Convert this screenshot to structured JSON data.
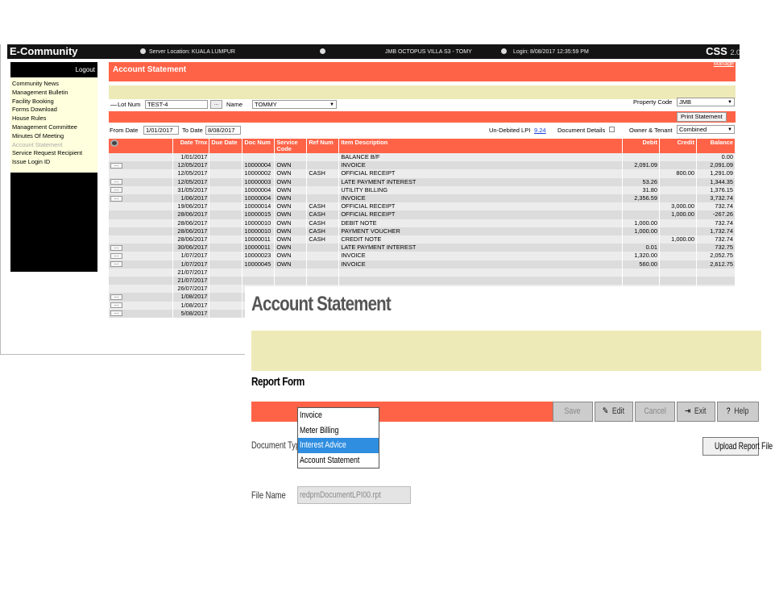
{
  "app": {
    "brand": "E-Community",
    "server_location": "Server Location: KUALA LUMPUR",
    "property": "JMB OCTOPUS VILLA S3 - TOMY",
    "login": "Login: 8/08/2017 12:35:59 PM",
    "product": "CSS",
    "version": "2.0"
  },
  "sidebar": {
    "logout": "Logout",
    "items": [
      {
        "label": "Community News"
      },
      {
        "label": "Management Bulletin"
      },
      {
        "label": "Facility Booking"
      },
      {
        "label": "Forms Download"
      },
      {
        "label": "House Rules"
      },
      {
        "label": "Management Committee"
      },
      {
        "label": "Minutes Of Meeting"
      },
      {
        "label": "Account Statement"
      },
      {
        "label": "Service Request Recipient"
      },
      {
        "label": "Issue Login ID"
      }
    ]
  },
  "statement": {
    "title": "Account Statement",
    "manage_link": "Manage",
    "lot_label": "Lot Num",
    "lot_value": "TEST-4",
    "lookup_btn": "...",
    "name_label": "Name",
    "name_value": "TOMMY",
    "property_code_label": "Property Code",
    "property_code_value": "JMB",
    "print_btn": "Print Statement",
    "from_date_label": "From Date",
    "from_date_value": "1/01/2017",
    "to_date_label": "To Date",
    "to_date_value": "8/08/2017",
    "undebited_label": "Un-Debited LPI",
    "undebited_value": "9.24",
    "doc_details_label": "Document Details",
    "owner_tenant_label": "Owner & Tenant",
    "owner_tenant_value": "Combined",
    "columns": [
      "Date Trnx",
      "Due Date",
      "Doc Num",
      "Service Code",
      "Ref Num",
      "Item Description",
      "Debit",
      "Credit",
      "Balance"
    ],
    "rows": [
      {
        "btn": false,
        "date": "1/01/2017",
        "due": "",
        "doc": "",
        "svc": "",
        "ref": "",
        "desc": "BALANCE B/F",
        "debit": "",
        "credit": "",
        "balance": "0.00"
      },
      {
        "btn": true,
        "date": "12/05/2017",
        "due": "",
        "doc": "10000004",
        "svc": "OWN",
        "ref": "",
        "desc": "INVOICE",
        "debit": "2,091.09",
        "credit": "",
        "balance": "2,091.09"
      },
      {
        "btn": false,
        "date": "12/05/2017",
        "due": "",
        "doc": "10000002",
        "svc": "OWN",
        "ref": "CASH",
        "desc": "OFFICIAL RECEIPT",
        "debit": "",
        "credit": "800.00",
        "balance": "1,291.09"
      },
      {
        "btn": true,
        "date": "12/05/2017",
        "due": "",
        "doc": "10000003",
        "svc": "OWN",
        "ref": "",
        "desc": "LATE PAYMENT INTEREST",
        "debit": "53.26",
        "credit": "",
        "balance": "1,344.35"
      },
      {
        "btn": true,
        "date": "31/05/2017",
        "due": "",
        "doc": "10000004",
        "svc": "OWN",
        "ref": "",
        "desc": "UTILITY BILLING",
        "debit": "31.80",
        "credit": "",
        "balance": "1,376.15"
      },
      {
        "btn": true,
        "date": "1/06/2017",
        "due": "",
        "doc": "10000004",
        "svc": "OWN",
        "ref": "",
        "desc": "INVOICE",
        "debit": "2,356.59",
        "credit": "",
        "balance": "3,732.74"
      },
      {
        "btn": false,
        "date": "19/06/2017",
        "due": "",
        "doc": "10000014",
        "svc": "OWN",
        "ref": "CASH",
        "desc": "OFFICIAL RECEIPT",
        "debit": "",
        "credit": "3,000.00",
        "balance": "732.74"
      },
      {
        "btn": false,
        "date": "28/06/2017",
        "due": "",
        "doc": "10000015",
        "svc": "OWN",
        "ref": "CASH",
        "desc": "OFFICIAL RECEIPT",
        "debit": "",
        "credit": "1,000.00",
        "balance": "-267.26"
      },
      {
        "btn": false,
        "date": "28/06/2017",
        "due": "",
        "doc": "10000010",
        "svc": "OWN",
        "ref": "CASH",
        "desc": "DEBIT NOTE",
        "debit": "1,000.00",
        "credit": "",
        "balance": "732.74"
      },
      {
        "btn": false,
        "date": "28/06/2017",
        "due": "",
        "doc": "10000010",
        "svc": "OWN",
        "ref": "CASH",
        "desc": "PAYMENT VOUCHER",
        "debit": "1,000.00",
        "credit": "",
        "balance": "1,732.74"
      },
      {
        "btn": false,
        "date": "28/06/2017",
        "due": "",
        "doc": "10000011",
        "svc": "OWN",
        "ref": "CASH",
        "desc": "CREDIT NOTE",
        "debit": "",
        "credit": "1,000.00",
        "balance": "732.74"
      },
      {
        "btn": true,
        "date": "30/06/2017",
        "due": "",
        "doc": "10000011",
        "svc": "OWN",
        "ref": "",
        "desc": "LATE PAYMENT INTEREST",
        "debit": "0.01",
        "credit": "",
        "balance": "732.75"
      },
      {
        "btn": true,
        "date": "1/07/2017",
        "due": "",
        "doc": "10000023",
        "svc": "OWN",
        "ref": "",
        "desc": "INVOICE",
        "debit": "1,320.00",
        "credit": "",
        "balance": "2,052.75"
      },
      {
        "btn": true,
        "date": "1/07/2017",
        "due": "",
        "doc": "10000045",
        "svc": "OWN",
        "ref": "",
        "desc": "INVOICE",
        "debit": "560.00",
        "credit": "",
        "balance": "2,612.75"
      },
      {
        "btn": false,
        "date": "21/07/2017",
        "due": "",
        "doc": "",
        "svc": "",
        "ref": "",
        "desc": "",
        "debit": "",
        "credit": "",
        "balance": ""
      },
      {
        "btn": false,
        "date": "21/07/2017",
        "due": "",
        "doc": "",
        "svc": "",
        "ref": "",
        "desc": "",
        "debit": "",
        "credit": "",
        "balance": ""
      },
      {
        "btn": false,
        "date": "26/07/2017",
        "due": "",
        "doc": "",
        "svc": "",
        "ref": "",
        "desc": "",
        "debit": "",
        "credit": "",
        "balance": ""
      },
      {
        "btn": true,
        "date": "1/08/2017",
        "due": "",
        "doc": "",
        "svc": "",
        "ref": "",
        "desc": "",
        "debit": "",
        "credit": "",
        "balance": ""
      },
      {
        "btn": true,
        "date": "1/08/2017",
        "due": "",
        "doc": "",
        "svc": "",
        "ref": "",
        "desc": "",
        "debit": "",
        "credit": "",
        "balance": ""
      },
      {
        "btn": true,
        "date": "5/08/2017",
        "due": "",
        "doc": "",
        "svc": "",
        "ref": "",
        "desc": "",
        "debit": "",
        "credit": "",
        "balance": ""
      }
    ]
  },
  "report": {
    "title": "Account Statement",
    "form_title": "Report Form",
    "buttons": {
      "save": "Save",
      "edit": "Edit",
      "cancel": "Cancel",
      "exit": "Exit",
      "help": "Help"
    },
    "doc_type_label": "Document Type",
    "doc_type_options": [
      "Invoice",
      "Meter Billing",
      "Interest Advice",
      "Account Statement"
    ],
    "doc_type_selected": "Interest Advice",
    "upload_btn": "Upload Report File",
    "file_name_label": "File Name",
    "file_name_value": "redpmDocumentLPI00.rpt"
  },
  "colors": {
    "accent": "#ff6347",
    "band": "#eeeab8",
    "selected": "#2f8ee0"
  }
}
